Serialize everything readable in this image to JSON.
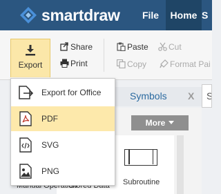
{
  "app": {
    "brand": "smartdraw"
  },
  "menu": {
    "file": "File",
    "home": "Home",
    "more_partial": "S"
  },
  "ribbon": {
    "export_label": "Export",
    "share_label": "Share",
    "print_label": "Print",
    "paste_label": "Paste",
    "cut_label": "Cut",
    "copy_label": "Copy",
    "format_painter_label": "Format Pai"
  },
  "export_menu": {
    "items": [
      {
        "label": "Export for Office",
        "icon": "export-office-icon"
      },
      {
        "label": "PDF",
        "icon": "pdf-file-icon"
      },
      {
        "label": "SVG",
        "icon": "svg-file-icon"
      },
      {
        "label": "PNG",
        "icon": "png-file-icon"
      }
    ],
    "highlighted": "PDF"
  },
  "symbols_panel": {
    "title": "Symbols",
    "close_label": "X",
    "more_label": "More",
    "right_tab_partial": "S",
    "shapes": [
      {
        "label": "Subroutine"
      }
    ],
    "cut_labels": [
      "Manual Operation",
      "Stored Data"
    ]
  },
  "colors": {
    "topbar": "#2b5680",
    "active_menu": "#1f4566",
    "highlight": "#fde9ab",
    "accent_text": "#2b6aa0"
  }
}
